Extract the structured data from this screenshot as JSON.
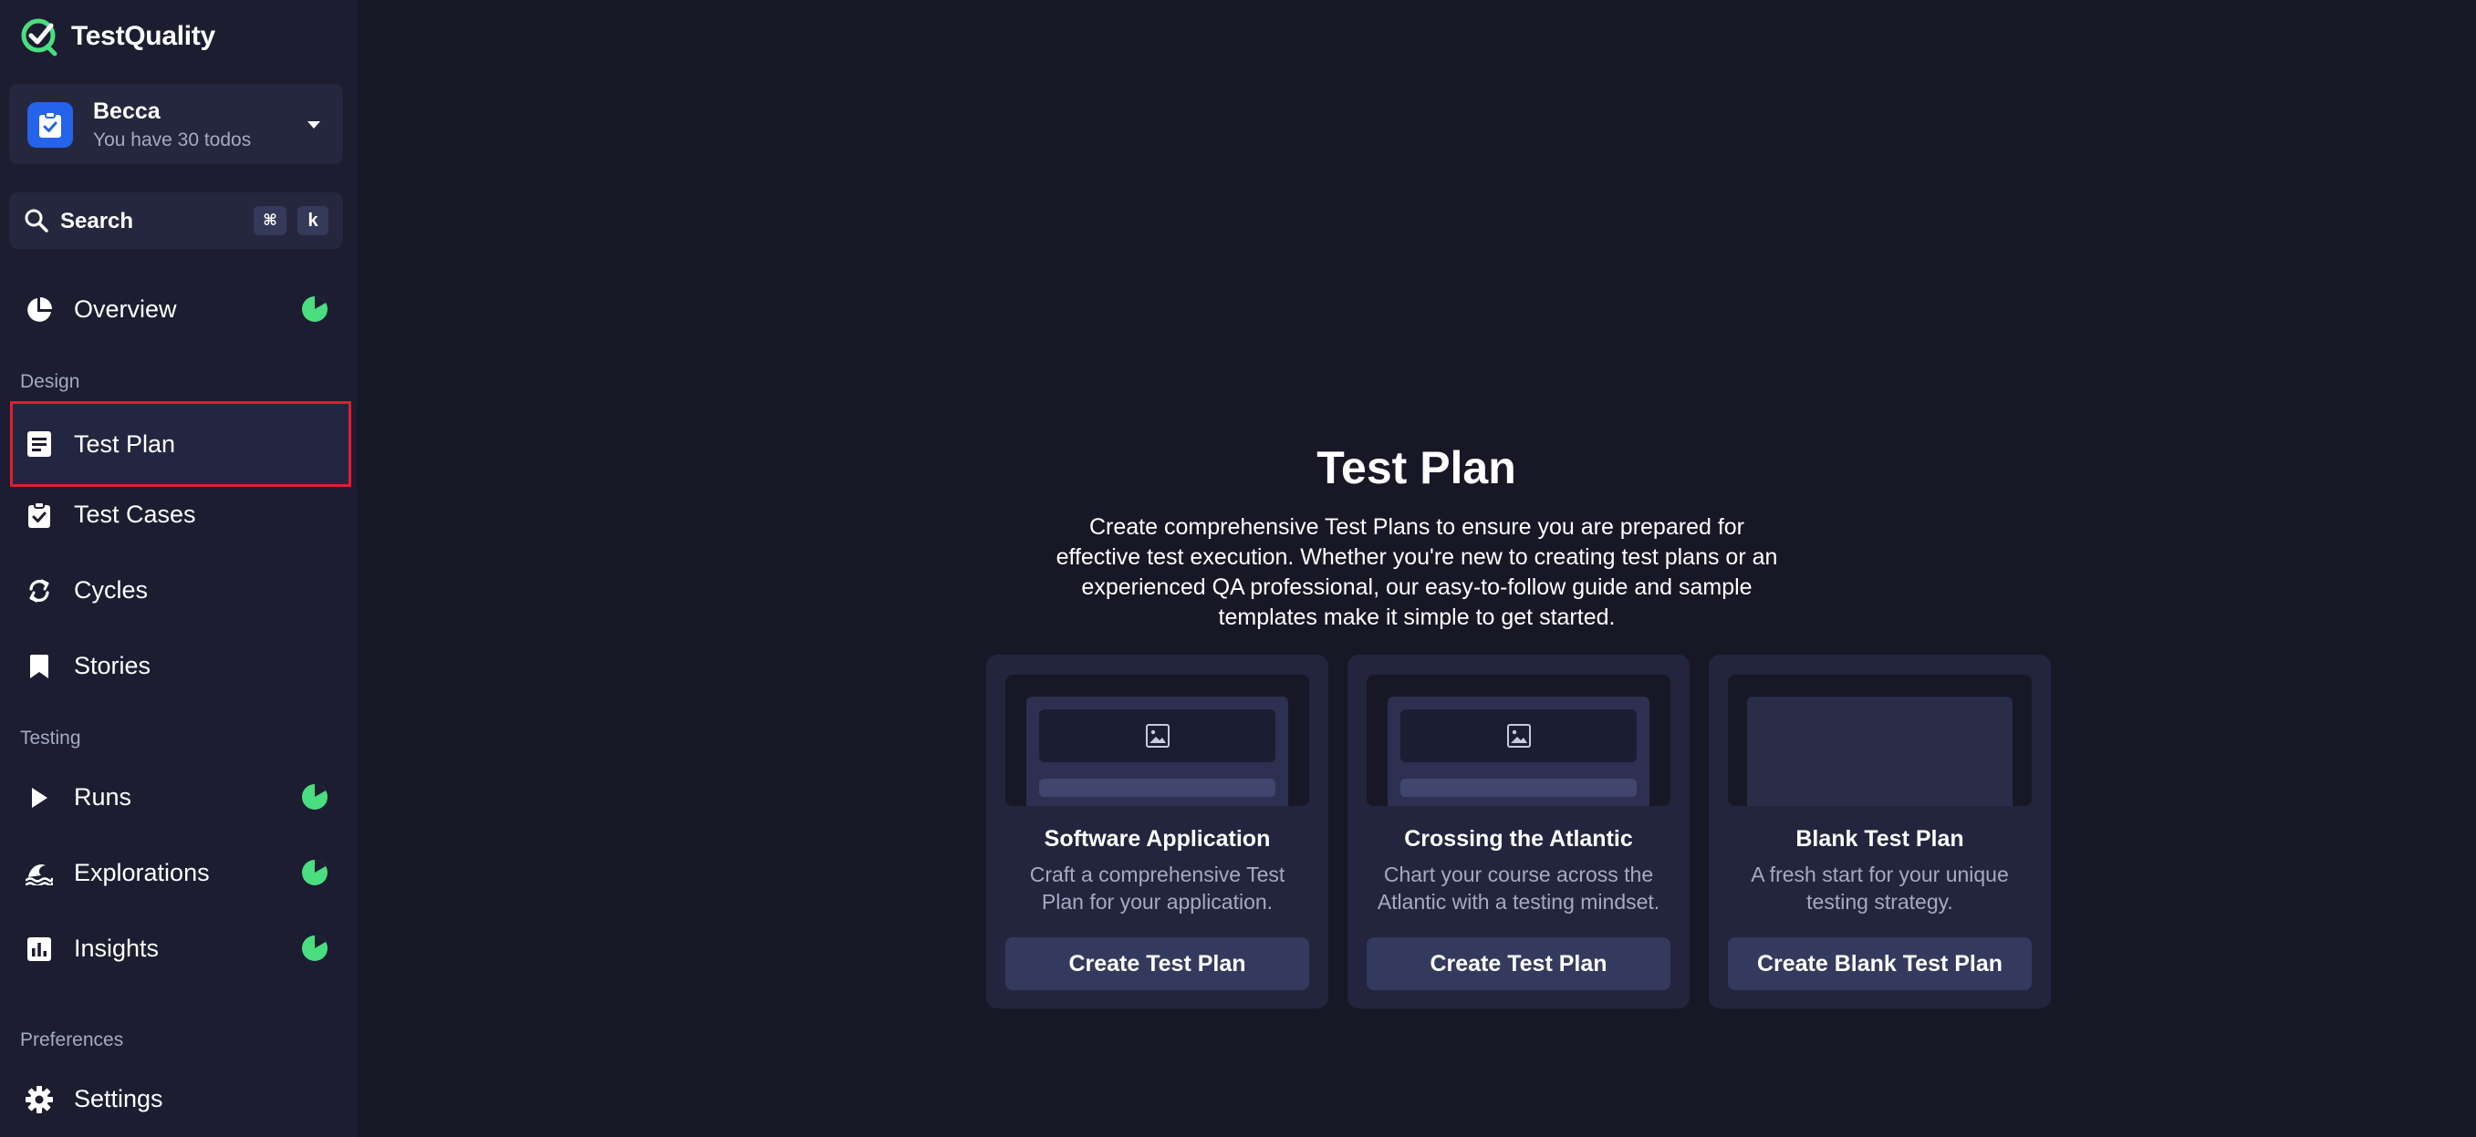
{
  "app": {
    "name": "TestQuality"
  },
  "user": {
    "name": "Becca",
    "subtitle": "You have 30 todos"
  },
  "search": {
    "label": "Search",
    "shortcut_mod": "⌘",
    "shortcut_key": "k"
  },
  "nav": {
    "overview": "Overview",
    "section_design": "Design",
    "test_plan": "Test Plan",
    "test_cases": "Test Cases",
    "cycles": "Cycles",
    "stories": "Stories",
    "section_testing": "Testing",
    "runs": "Runs",
    "explorations": "Explorations",
    "insights": "Insights",
    "section_preferences": "Preferences",
    "settings": "Settings"
  },
  "main": {
    "title": "Test Plan",
    "description": "Create comprehensive Test Plans to ensure you are prepared for effective test execution. Whether you're new to creating test plans or an experienced QA professional, our easy-to-follow guide and sample templates make it simple to get started.",
    "cards": [
      {
        "title": "Software Application",
        "description": "Craft a comprehensive Test Plan for your application.",
        "button": "Create Test Plan"
      },
      {
        "title": "Crossing the Atlantic",
        "description": "Chart your course across the Atlantic with a testing mindset.",
        "button": "Create Test Plan"
      },
      {
        "title": "Blank Test Plan",
        "description": "A fresh start for your unique testing strategy.",
        "button": "Create Blank Test Plan"
      }
    ]
  },
  "colors": {
    "background": "#171726",
    "sidebar": "#1c1d31",
    "accent_blue": "#2563eb",
    "status_green": "#4ade80",
    "highlight_red": "#e11d2d"
  },
  "icons": {
    "logo": "testquality-logo-icon",
    "user": "clipboard-check-icon",
    "search": "search-icon",
    "overview": "pie-chart-icon",
    "test_plan": "document-icon",
    "test_cases": "clipboard-check-icon",
    "cycles": "refresh-icon",
    "stories": "bookmark-icon",
    "runs": "play-icon",
    "explorations": "wave-icon",
    "insights": "bar-chart-icon",
    "settings": "gear-icon",
    "status": "pie-progress-icon",
    "preview": "image-icon"
  }
}
